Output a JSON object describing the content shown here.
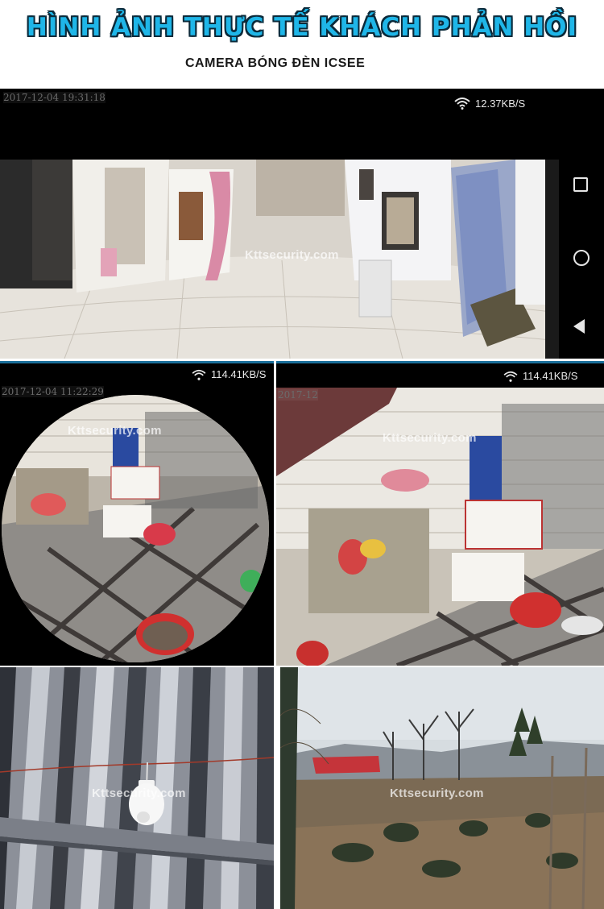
{
  "header": {
    "title": "HÌNH ẢNH THỰC TẾ KHÁCH PHẢN HỒI",
    "subtitle": "CAMERA BÓNG ĐÈN ICSEE"
  },
  "panels": {
    "top": {
      "timestamp": "2017-12-04 19:31:18",
      "speed": "12.37KB/S",
      "watermark": "Kttsecurity.com"
    },
    "mid_left": {
      "timestamp": "2017-12-04 11:22:29",
      "speed": "114.41KB/S",
      "watermark": "Kttsecurity.com"
    },
    "mid_right": {
      "timestamp": "2017-12",
      "speed": "114.41KB/S",
      "watermark": "Kttsecurity.com"
    },
    "bottom_left": {
      "watermark": "Kttsecurity.com"
    },
    "bottom_right": {
      "watermark": "Kttsecurity.com"
    }
  },
  "colors": {
    "title": "#1fb6e8",
    "title_outline": "#0b2a3a",
    "accent_bar": "#1a6f9a"
  },
  "icons": [
    "wifi-icon",
    "recent-apps-icon",
    "home-icon",
    "back-icon"
  ]
}
